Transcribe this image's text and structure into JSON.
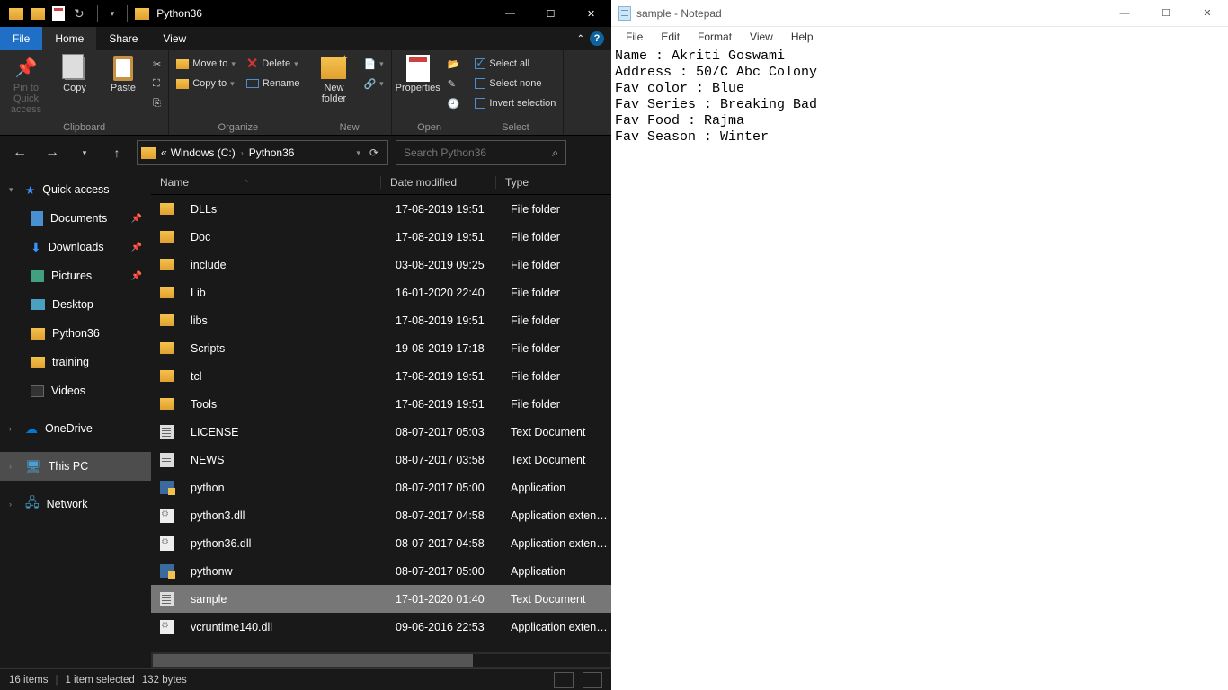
{
  "explorer": {
    "title": "Python36",
    "menuTabs": {
      "file": "File",
      "home": "Home",
      "share": "Share",
      "view": "View"
    },
    "ribbon": {
      "pin": "Pin to Quick access",
      "copy": "Copy",
      "paste": "Paste",
      "moveTo": "Move to",
      "copyTo": "Copy to",
      "delete": "Delete",
      "rename": "Rename",
      "newFolder": "New folder",
      "properties": "Properties",
      "selectAll": "Select all",
      "selectNone": "Select none",
      "invert": "Invert selection",
      "gClipboard": "Clipboard",
      "gOrganize": "Organize",
      "gNew": "New",
      "gOpen": "Open",
      "gSelect": "Select"
    },
    "breadcrumb": {
      "root": "Windows (C:)",
      "folder": "Python36"
    },
    "searchPlaceholder": "Search Python36",
    "nav": {
      "quickAccess": "Quick access",
      "documents": "Documents",
      "downloads": "Downloads",
      "pictures": "Pictures",
      "desktop": "Desktop",
      "python36": "Python36",
      "training": "training",
      "videos": "Videos",
      "onedrive": "OneDrive",
      "thisPC": "This PC",
      "network": "Network"
    },
    "columns": {
      "name": "Name",
      "date": "Date modified",
      "type": "Type"
    },
    "files": [
      {
        "name": "DLLs",
        "date": "17-08-2019 19:51",
        "type": "File folder",
        "icon": "folder"
      },
      {
        "name": "Doc",
        "date": "17-08-2019 19:51",
        "type": "File folder",
        "icon": "folder"
      },
      {
        "name": "include",
        "date": "03-08-2019 09:25",
        "type": "File folder",
        "icon": "folder"
      },
      {
        "name": "Lib",
        "date": "16-01-2020 22:40",
        "type": "File folder",
        "icon": "folder"
      },
      {
        "name": "libs",
        "date": "17-08-2019 19:51",
        "type": "File folder",
        "icon": "folder"
      },
      {
        "name": "Scripts",
        "date": "19-08-2019 17:18",
        "type": "File folder",
        "icon": "folder"
      },
      {
        "name": "tcl",
        "date": "17-08-2019 19:51",
        "type": "File folder",
        "icon": "folder"
      },
      {
        "name": "Tools",
        "date": "17-08-2019 19:51",
        "type": "File folder",
        "icon": "folder"
      },
      {
        "name": "LICENSE",
        "date": "08-07-2017 05:03",
        "type": "Text Document",
        "icon": "txt"
      },
      {
        "name": "NEWS",
        "date": "08-07-2017 03:58",
        "type": "Text Document",
        "icon": "txt"
      },
      {
        "name": "python",
        "date": "08-07-2017 05:00",
        "type": "Application",
        "icon": "exe"
      },
      {
        "name": "python3.dll",
        "date": "08-07-2017 04:58",
        "type": "Application exten…",
        "icon": "dll"
      },
      {
        "name": "python36.dll",
        "date": "08-07-2017 04:58",
        "type": "Application exten…",
        "icon": "dll"
      },
      {
        "name": "pythonw",
        "date": "08-07-2017 05:00",
        "type": "Application",
        "icon": "exe"
      },
      {
        "name": "sample",
        "date": "17-01-2020 01:40",
        "type": "Text Document",
        "icon": "txt",
        "selected": true
      },
      {
        "name": "vcruntime140.dll",
        "date": "09-06-2016 22:53",
        "type": "Application exten…",
        "icon": "dll"
      }
    ],
    "status": {
      "count": "16 items",
      "selected": "1 item selected",
      "size": "132 bytes"
    }
  },
  "notepad": {
    "title": "sample - Notepad",
    "menu": {
      "file": "File",
      "edit": "Edit",
      "format": "Format",
      "view": "View",
      "help": "Help"
    },
    "content": "Name : Akriti Goswami\nAddress : 50/C Abc Colony\nFav color : Blue\nFav Series : Breaking Bad\nFav Food : Rajma\nFav Season : Winter"
  }
}
